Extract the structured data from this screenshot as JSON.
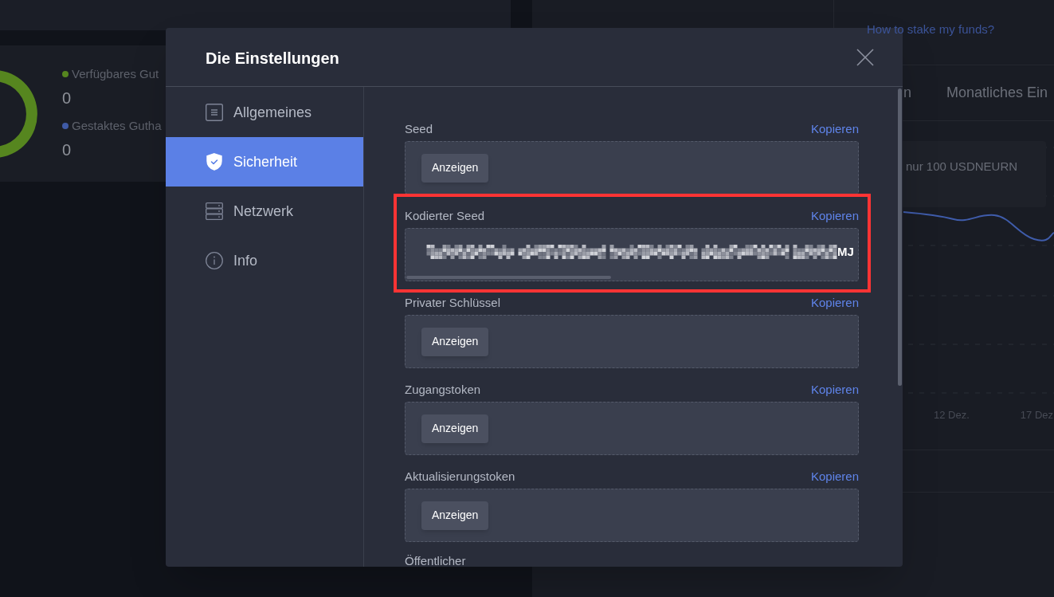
{
  "background": {
    "balance_legend": [
      {
        "label": "Verfügbares Gut",
        "value": "0",
        "color": "#56861f"
      },
      {
        "label": "Gestaktes Gutha",
        "value": "0",
        "color": "#3f5aa6"
      }
    ],
    "help_link": "How to stake my funds?",
    "tabs": [
      {
        "label": "n"
      },
      {
        "label": "Monatliches Ein"
      }
    ],
    "promo_text": "nur 100 USDNEURN",
    "chart": {
      "x_labels": [
        "12 Dez.",
        "17 Dez"
      ]
    }
  },
  "dialog": {
    "title": "Die Einstellungen",
    "sidebar": {
      "items": [
        {
          "label": "Allgemeines",
          "selected": false
        },
        {
          "label": "Sicherheit",
          "selected": true
        },
        {
          "label": "Netzwerk",
          "selected": false
        },
        {
          "label": "Info",
          "selected": false
        }
      ]
    },
    "fields": [
      {
        "label": "Seed",
        "action": "Kopieren",
        "kind": "hidden",
        "button": "Anzeigen",
        "highlighted": false
      },
      {
        "label": "Kodierter Seed",
        "action": "Kopieren",
        "kind": "revealed",
        "redacted": true,
        "value": "MJ",
        "highlighted": true
      },
      {
        "label": "Privater Schlüssel",
        "action": "Kopieren",
        "kind": "hidden",
        "button": "Anzeigen",
        "highlighted": false
      },
      {
        "label": "Zugangstoken",
        "action": "Kopieren",
        "kind": "hidden",
        "button": "Anzeigen",
        "highlighted": false
      },
      {
        "label": "Aktualisierungstoken",
        "action": "Kopieren",
        "kind": "hidden",
        "button": "Anzeigen",
        "highlighted": false
      }
    ],
    "cut_label": "Öffentlicher"
  }
}
